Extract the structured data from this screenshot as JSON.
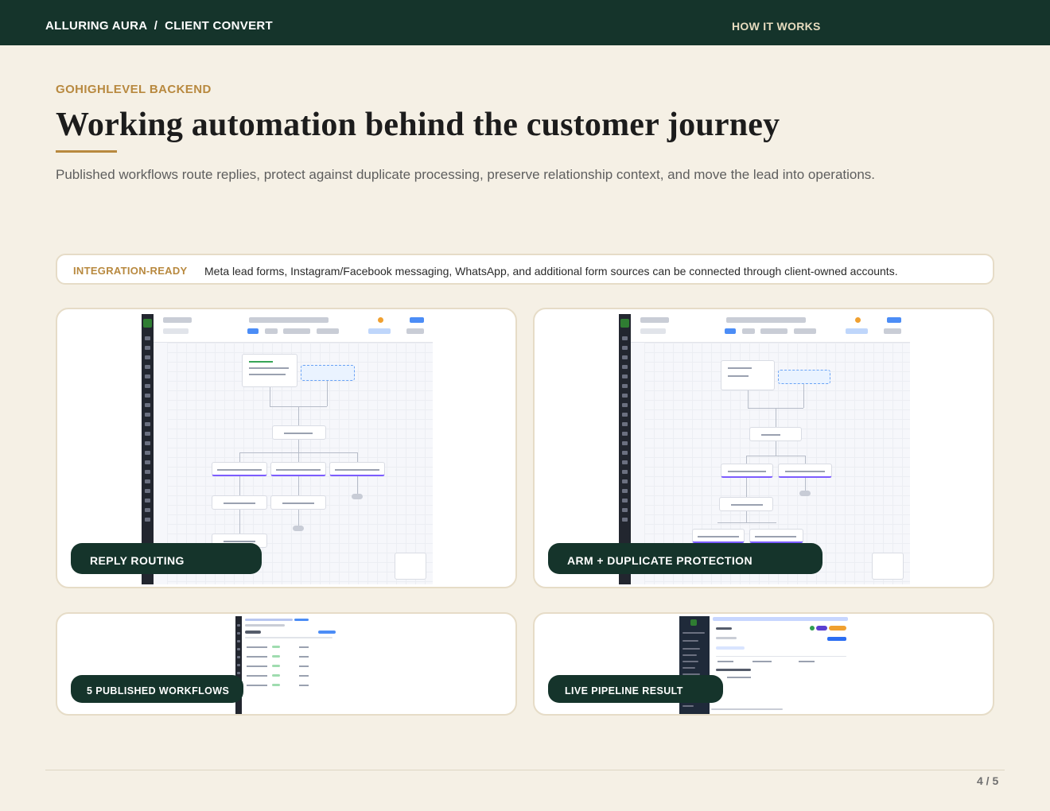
{
  "header": {
    "brand": "ALLURING AURA  /  CLIENT CONVERT",
    "section": "HOW IT WORKS"
  },
  "intro": {
    "eyebrow": "GOHIGHLEVEL BACKEND",
    "title": "Working automation behind the customer journey",
    "subtitle": "Published workflows route replies, protect against duplicate processing, preserve relationship context, and move the lead into operations."
  },
  "integration": {
    "tag": "INTEGRATION-READY",
    "description": "Meta lead forms, Instagram/Facebook messaging, WhatsApp, and additional form sources can be connected through client-owned accounts."
  },
  "cards": [
    {
      "label": "REPLY ROUTING",
      "screenshot": "inbound-reply-router-workflow"
    },
    {
      "label": "ARM + DUPLICATE PROTECTION",
      "screenshot": "consultation-router-workflow"
    },
    {
      "label": "5 PUBLISHED WORKFLOWS",
      "screenshot": "workflows-list"
    },
    {
      "label": "LIVE PIPELINE RESULT",
      "screenshot": "opportunities-pipeline"
    }
  ],
  "colors": {
    "header_bg": "#15342b",
    "page_bg": "#f5f0e5",
    "accent_gold": "#b8893f",
    "badge_bg": "#15342b"
  },
  "footer": {
    "page": "4 / 5"
  }
}
